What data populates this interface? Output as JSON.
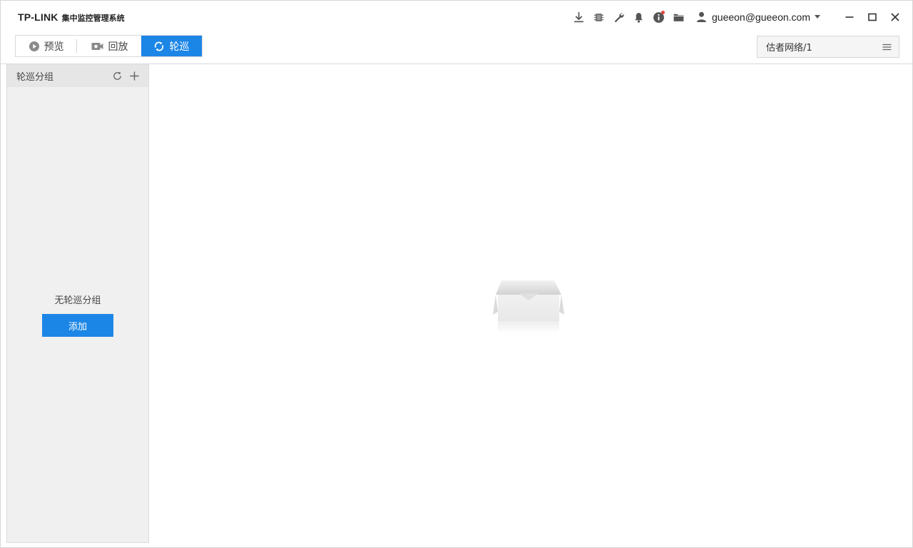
{
  "app": {
    "brand_logo": "TP-LINK",
    "brand_subtitle": "集中监控管理系统"
  },
  "toolbar": {
    "icons": [
      "download-icon",
      "chip-icon",
      "wrench-icon",
      "bell-icon",
      "info-icon",
      "folder-icon"
    ],
    "user_email": "gueeon@gueeon.com"
  },
  "tabs": {
    "preview": "预览",
    "playback": "回放",
    "patrol": "轮巡"
  },
  "network_select": {
    "value": "估者网络/1"
  },
  "sidebar": {
    "title": "轮巡分组",
    "empty_text": "无轮巡分组",
    "add_label": "添加"
  },
  "colors": {
    "accent": "#1c86e6",
    "sidebar_bg": "#f0f0f0",
    "badge": "#e8453c"
  }
}
